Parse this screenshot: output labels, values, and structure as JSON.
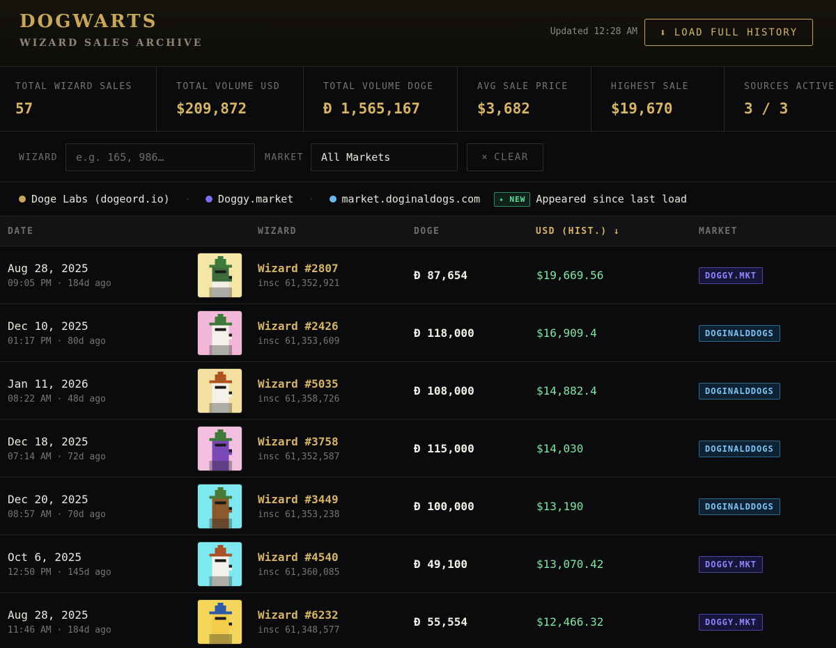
{
  "header": {
    "title": "DOGWARTS",
    "subtitle": "WIZARD SALES ARCHIVE",
    "updated": "Updated 12:28 AM",
    "load_button": "LOAD FULL HISTORY"
  },
  "stats": [
    {
      "label": "TOTAL WIZARD SALES",
      "value": "57"
    },
    {
      "label": "TOTAL VOLUME USD",
      "value": "$209,872"
    },
    {
      "label": "TOTAL VOLUME DOGE",
      "value": "Đ 1,565,167"
    },
    {
      "label": "AVG SALE PRICE",
      "value": "$3,682"
    },
    {
      "label": "HIGHEST SALE",
      "value": "$19,670"
    },
    {
      "label": "SOURCES ACTIVE",
      "value": "3 / 3"
    }
  ],
  "filters": {
    "wizard_label": "WIZARD",
    "wizard_placeholder": "e.g. 165, 986…",
    "market_label": "MARKET",
    "market_value": "All Markets",
    "clear_label": "CLEAR"
  },
  "legend": {
    "sources": [
      {
        "label": "Doge Labs (dogeord.io)",
        "color": "#c9a75a"
      },
      {
        "label": "Doggy.market",
        "color": "#7a6ff0"
      },
      {
        "label": "market.doginaldogs.com",
        "color": "#6bb8ee"
      }
    ],
    "new_badge": "✦ NEW",
    "new_text": "Appeared since last load"
  },
  "table": {
    "headers": {
      "date": "DATE",
      "wizard": "WIZARD",
      "doge": "DOGE",
      "usd": "USD (HIST.) ↓",
      "market": "MARKET"
    },
    "rows": [
      {
        "date": "Aug 28, 2025",
        "time": "09:05 PM · 184d ago",
        "wizard": "Wizard #2807",
        "insc": "insc 61,352,921",
        "doge": "Đ 87,654",
        "usd": "$19,669.56",
        "market": "DOGGY.MKT",
        "mkt": "doggy",
        "bg": "#f3e6a6",
        "hat": "#3e7a3a",
        "fur": "#f2efe6",
        "face": "#3d6d3a"
      },
      {
        "date": "Dec 10, 2025",
        "time": "01:17 PM · 80d ago",
        "wizard": "Wizard #2426",
        "insc": "insc 61,353,609",
        "doge": "Đ 118,000",
        "usd": "$16,909.4",
        "market": "DOGINALDDOGS",
        "mkt": "dd",
        "bg": "#f2b6d8",
        "hat": "#3e7a3a",
        "fur": "#f4f1ea",
        "face": "#f4f1ea"
      },
      {
        "date": "Jan 11, 2026",
        "time": "08:22 AM · 48d ago",
        "wizard": "Wizard #5035",
        "insc": "insc 61,358,726",
        "doge": "Đ 108,000",
        "usd": "$14,882.4",
        "market": "DOGINALDDOGS",
        "mkt": "dd",
        "bg": "#f3e0a0",
        "hat": "#b0541f",
        "fur": "#f4f1ea",
        "face": "#f4f1ea"
      },
      {
        "date": "Dec 18, 2025",
        "time": "07:14 AM · 72d ago",
        "wizard": "Wizard #3758",
        "insc": "insc 61,352,587",
        "doge": "Đ 115,000",
        "usd": "$14,030",
        "market": "DOGINALDDOGS",
        "mkt": "dd",
        "bg": "#f2bfe0",
        "hat": "#3e7a3a",
        "fur": "#7b49b5",
        "face": "#7b49b5"
      },
      {
        "date": "Dec 20, 2025",
        "time": "08:57 AM · 70d ago",
        "wizard": "Wizard #3449",
        "insc": "insc 61,353,238",
        "doge": "Đ 100,000",
        "usd": "$13,190",
        "market": "DOGINALDDOGS",
        "mkt": "dd",
        "bg": "#7de8ef",
        "hat": "#4a7a3a",
        "fur": "#8a5a2c",
        "face": "#8a5a2c"
      },
      {
        "date": "Oct 6, 2025",
        "time": "12:50 PM · 145d ago",
        "wizard": "Wizard #4540",
        "insc": "insc 61,360,085",
        "doge": "Đ 49,100",
        "usd": "$13,070.42",
        "market": "DOGGY.MKT",
        "mkt": "doggy",
        "bg": "#7de8ef",
        "hat": "#a8522a",
        "fur": "#f4f1ea",
        "face": "#f4f1ea"
      },
      {
        "date": "Aug 28, 2025",
        "time": "11:46 AM · 184d ago",
        "wizard": "Wizard #6232",
        "insc": "insc 61,348,577",
        "doge": "Đ 55,554",
        "usd": "$12,466.32",
        "market": "DOGGY.MKT",
        "mkt": "doggy",
        "bg": "#f3d65a",
        "hat": "#2f5aa8",
        "fur": "#f2cc4a",
        "face": "#f2cc4a"
      }
    ]
  }
}
